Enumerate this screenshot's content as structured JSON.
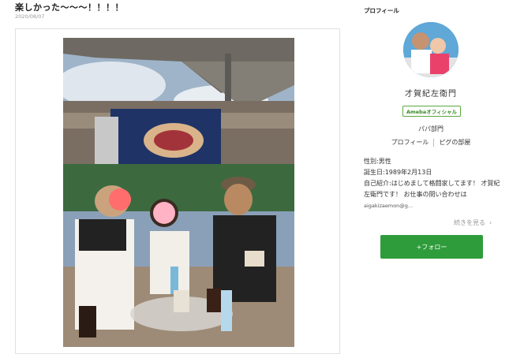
{
  "post": {
    "title": "楽しかった〜〜〜！！！！",
    "date": "2020/08/07"
  },
  "profile": {
    "heading": "プロフィール",
    "name": "才賀紀左衛門",
    "badge": "Amebaオフィシャル",
    "category": "パパ部門",
    "links": [
      "プロフィール",
      "ピグの部屋"
    ],
    "gender": "性別:男性",
    "birthday": "誕生日:1989年2月13日",
    "intro": "自己紹介:はじめまして格闘家してます！ 才賀紀左衛門です！ お仕事の問い合わせは",
    "email": "aigakizaemon@g...",
    "more_label": "続きを見る",
    "follow_label": "+フォロー"
  },
  "colors": {
    "follow_green": "#2f9c3b",
    "badge_green": "#3a8a26"
  }
}
